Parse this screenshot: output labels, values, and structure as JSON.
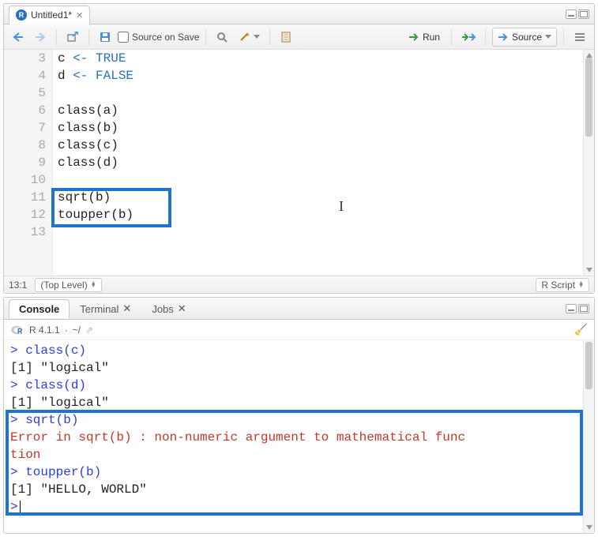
{
  "editor": {
    "tab_title": "Untitled1*",
    "toolbar": {
      "source_on_save": "Source on Save",
      "run": "Run",
      "source": "Source"
    },
    "gutter": [
      "3",
      "4",
      "5",
      "6",
      "7",
      "8",
      "9",
      "10",
      "11",
      "12",
      "13"
    ],
    "code_lines": [
      {
        "plain": "c ",
        "op": "<-",
        "val": " TRUE"
      },
      {
        "plain": "d ",
        "op": "<-",
        "val": " FALSE"
      },
      {
        "plain": ""
      },
      {
        "plain": "class(a)"
      },
      {
        "plain": "class(b)"
      },
      {
        "plain": "class(c)"
      },
      {
        "plain": "class(d)"
      },
      {
        "plain": ""
      },
      {
        "plain": "sqrt(b)"
      },
      {
        "plain": "toupper(b)"
      },
      {
        "plain": ""
      }
    ],
    "status": {
      "pos": "13:1",
      "scope": "(Top Level)",
      "type": "R Script"
    }
  },
  "console": {
    "tabs": {
      "console": "Console",
      "terminal": "Terminal",
      "jobs": "Jobs"
    },
    "version": "R 4.1.1",
    "path": "~/",
    "lines": [
      {
        "t": "cmd",
        "v": "class(c)"
      },
      {
        "t": "out",
        "v": "[1] \"logical\""
      },
      {
        "t": "cmd",
        "v": "class(d)"
      },
      {
        "t": "out",
        "v": "[1] \"logical\""
      },
      {
        "t": "cmd",
        "v": "sqrt(b)"
      },
      {
        "t": "err",
        "v": "Error in sqrt(b) : non-numeric argument to mathematical func"
      },
      {
        "t": "err",
        "v": "tion"
      },
      {
        "t": "cmd",
        "v": "toupper(b)"
      },
      {
        "t": "out",
        "v": "[1] \"HELLO, WORLD\""
      },
      {
        "t": "prompt",
        "v": ""
      }
    ]
  }
}
